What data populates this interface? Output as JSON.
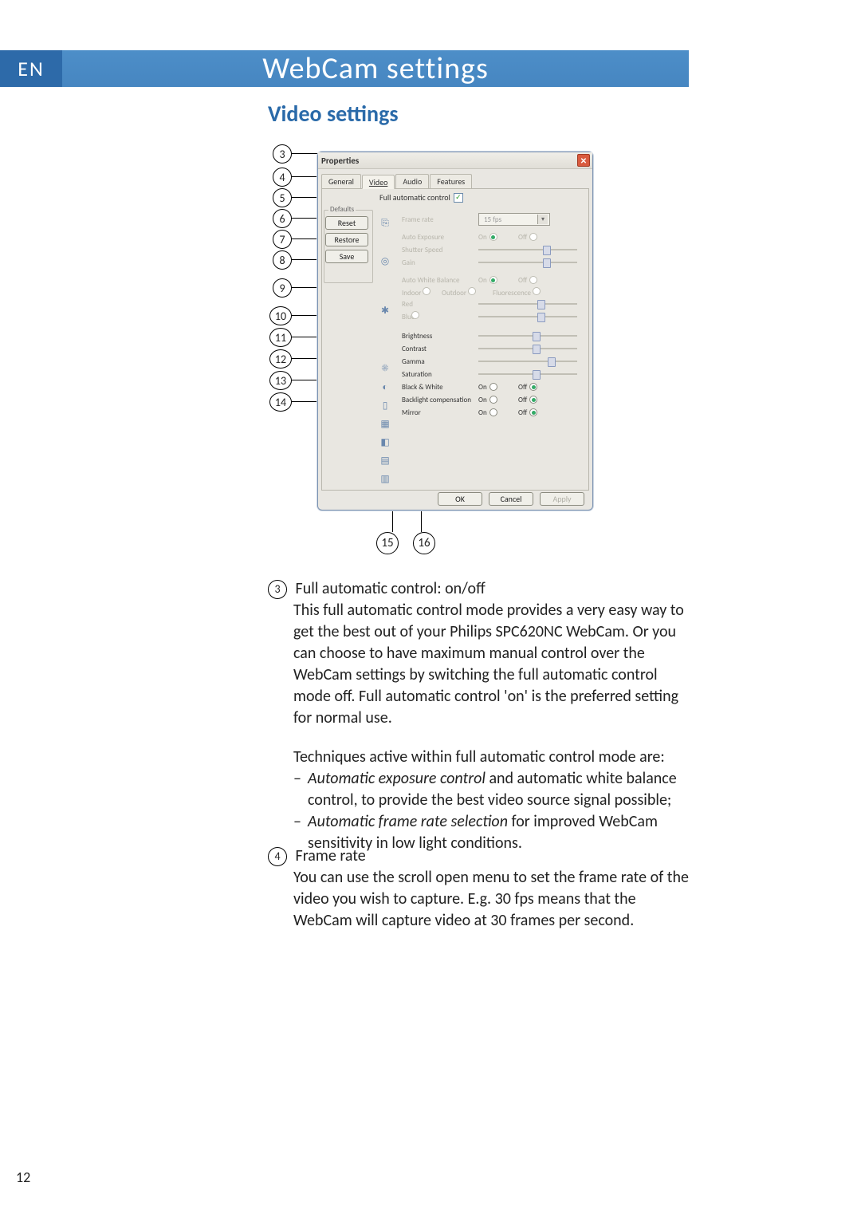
{
  "lang": "EN",
  "title": "WebCam settings",
  "section": "Video settings",
  "win": {
    "title": "Properties",
    "tabs": [
      "General",
      "Video",
      "Audio",
      "Features"
    ],
    "active_tab": 1,
    "defaults_label": "Defaults",
    "buttons": {
      "reset": "Reset",
      "restore": "Restore",
      "save": "Save"
    },
    "fac_label": "Full automatic control",
    "frame_rate_label": "Frame rate",
    "frame_rate_value": "15 fps",
    "rows": {
      "auto_exposure": "Auto Exposure",
      "shutter_speed": "Shutter Speed",
      "gain": "Gain",
      "auto_wb": "Auto White Balance",
      "indoor": "Indoor",
      "outdoor": "Outdoor",
      "fluorescence": "Fluorescence",
      "red": "Red",
      "blue": "Blue",
      "brightness": "Brightness",
      "contrast": "Contrast",
      "gamma": "Gamma",
      "saturation": "Saturation",
      "bw": "Black & White",
      "backlight": "Backlight compensation",
      "mirror": "Mirror"
    },
    "on": "On",
    "off": "Off",
    "dlg": {
      "ok": "OK",
      "cancel": "Cancel",
      "apply": "Apply"
    }
  },
  "callouts_left": [
    "3",
    "4",
    "5",
    "6",
    "7",
    "8",
    "9",
    "10",
    "11",
    "12",
    "13",
    "14"
  ],
  "callouts_bottom": [
    "15",
    "16"
  ],
  "b3": {
    "head": "Full automatic control: on/off",
    "p1": "This full automatic control mode provides a very easy way to get the best out of your Philips SPC620NC WebCam. Or you can choose to have maximum manual control over the WebCam settings by switching the full automatic control mode off. Full automatic control 'on' is the preferred setting for normal use.",
    "p2": "Techniques active within full automatic control mode are:",
    "li1a": "Automatic exposure control",
    "li1b": " and automatic white balance control, to provide the best video source signal possible;",
    "li2a": "Automatic frame rate selection",
    "li2b": " for improved WebCam sensitivity in low light conditions."
  },
  "b4": {
    "head": "Frame rate",
    "p1": "You can use the scroll open menu to set the frame rate of the video you wish to capture. E.g. 30 fps means that the WebCam will capture video at 30 frames per second."
  },
  "page_number": "12"
}
